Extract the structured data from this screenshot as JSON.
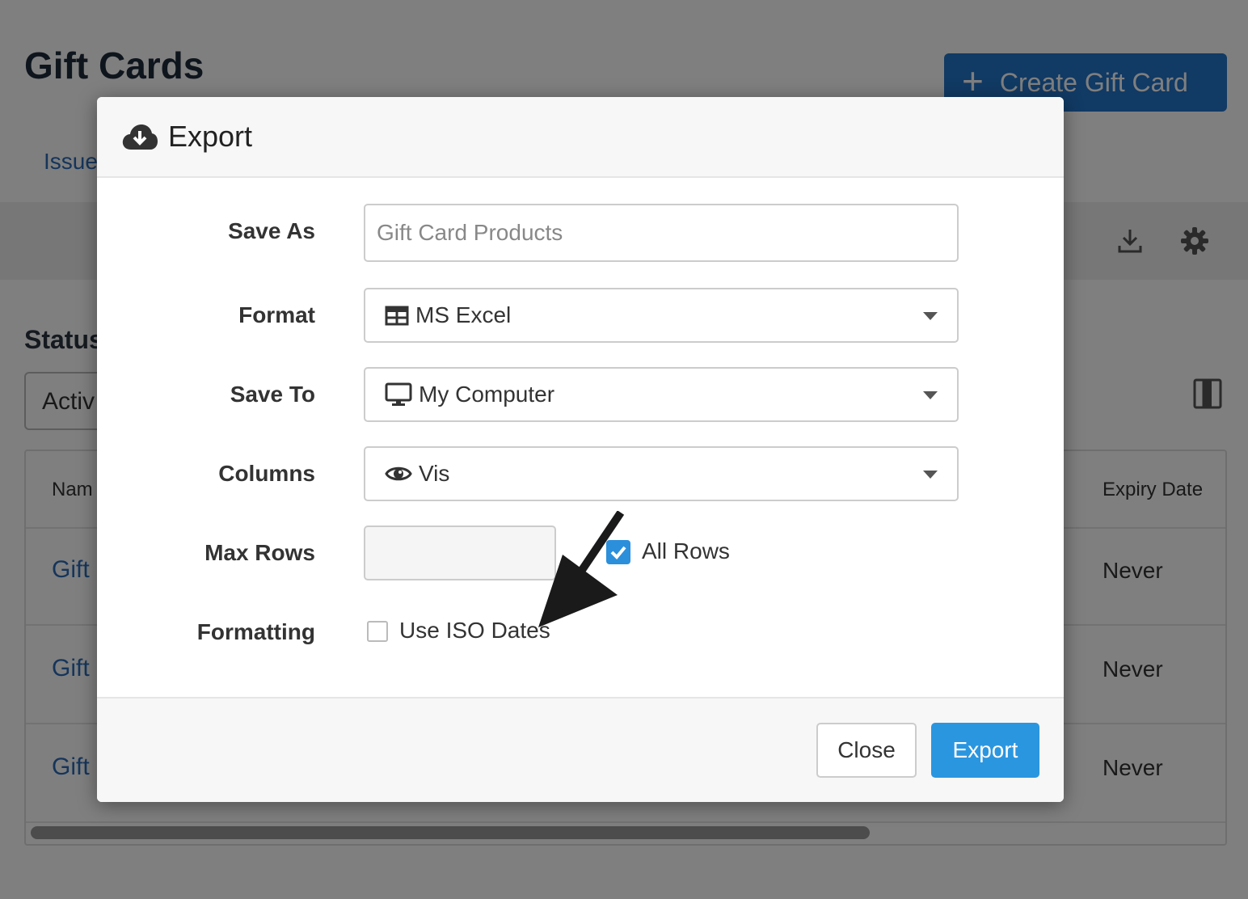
{
  "page": {
    "title": "Gift Cards",
    "create_button_label": "Create Gift Card",
    "tab_issued_label": "Issue",
    "status_label": "Status",
    "status_select_value": "Activ",
    "table": {
      "header_name": "Nam",
      "header_expiry": "Expiry Date",
      "rows": [
        {
          "name": "Gift",
          "expiry": "Never"
        },
        {
          "name": "Gift",
          "expiry": "Never"
        },
        {
          "name": "Gift",
          "expiry": "Never"
        }
      ]
    }
  },
  "modal": {
    "title": "Export",
    "fields": {
      "save_as": {
        "label": "Save As",
        "placeholder": "Gift Card Products"
      },
      "format": {
        "label": "Format",
        "value": "MS Excel"
      },
      "save_to": {
        "label": "Save To",
        "value": "My Computer"
      },
      "columns": {
        "label": "Columns",
        "value": "Vis"
      },
      "max_rows": {
        "label": "Max Rows",
        "value": ""
      },
      "all_rows": {
        "label": "All Rows",
        "checked": true
      },
      "formatting": {
        "label": "Formatting"
      },
      "iso_dates": {
        "label": "Use ISO Dates",
        "checked": false
      }
    },
    "buttons": {
      "close_label": "Close",
      "export_label": "Export"
    }
  },
  "colors": {
    "primary": "#2374c9",
    "export_button": "#2b96e0",
    "link": "#2a6bb6",
    "overlay": "rgba(0,0,0,0.5)"
  },
  "icons": {
    "header": "cloud-download-icon",
    "format": "table-icon",
    "save_to": "monitor-icon",
    "columns": "eye-icon"
  }
}
